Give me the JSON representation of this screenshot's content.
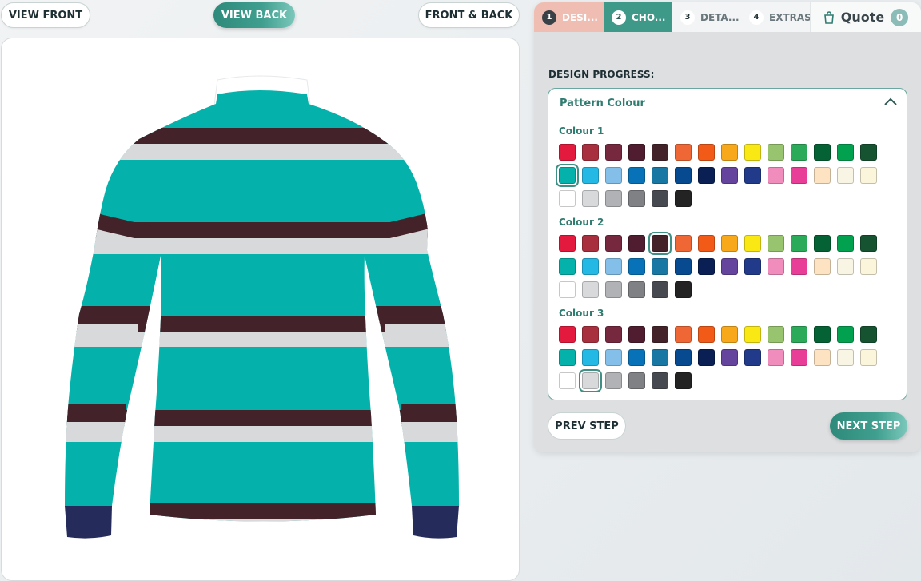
{
  "view": {
    "front_label": "VIEW FRONT",
    "back_label": "VIEW BACK",
    "both_label": "FRONT & BACK",
    "active": "back"
  },
  "steps": [
    {
      "num": "1",
      "label": "DESI..."
    },
    {
      "num": "2",
      "label": "CHO..."
    },
    {
      "num": "3",
      "label": "DETA..."
    },
    {
      "num": "4",
      "label": "EXTRAS"
    }
  ],
  "quote": {
    "label": "Quote",
    "count": "0"
  },
  "progress_label": "DESIGN PROGRESS:",
  "section": {
    "title": "Pattern Colour"
  },
  "palette": [
    "#e3193d",
    "#a82f3d",
    "#76283f",
    "#4f1d2f",
    "#432329",
    "#ee6735",
    "#f15a17",
    "#f7a81b",
    "#f9e814",
    "#99c46f",
    "#2baa59",
    "#046234",
    "#02a14f",
    "#155331",
    "#05b2ab",
    "#24b8e5",
    "#83bfe9",
    "#0872b8",
    "#1978a3",
    "#074a8f",
    "#0a1f53",
    "#65449d",
    "#223a8a",
    "#f08dbc",
    "#e83e97",
    "#fde3c1",
    "#f9f5e4",
    "#fbf5dc",
    "#ffffff",
    "#d8d9db",
    "#b0b2b5",
    "#7f8184",
    "#474950",
    "#232323"
  ],
  "colour_groups": [
    {
      "label": "Colour 1",
      "selected": "#05b2ab"
    },
    {
      "label": "Colour 2",
      "selected": "#432329"
    },
    {
      "label": "Colour 3",
      "selected": "#d8d9db"
    }
  ],
  "buttons": {
    "prev": "PREV STEP",
    "next": "NEXT STEP"
  },
  "colors": {
    "accent": "#3e9989",
    "cuff": "#252b5a",
    "stripe_dark": "#432329",
    "stripe_light": "#d8d9db",
    "body": "#05b2ab"
  }
}
